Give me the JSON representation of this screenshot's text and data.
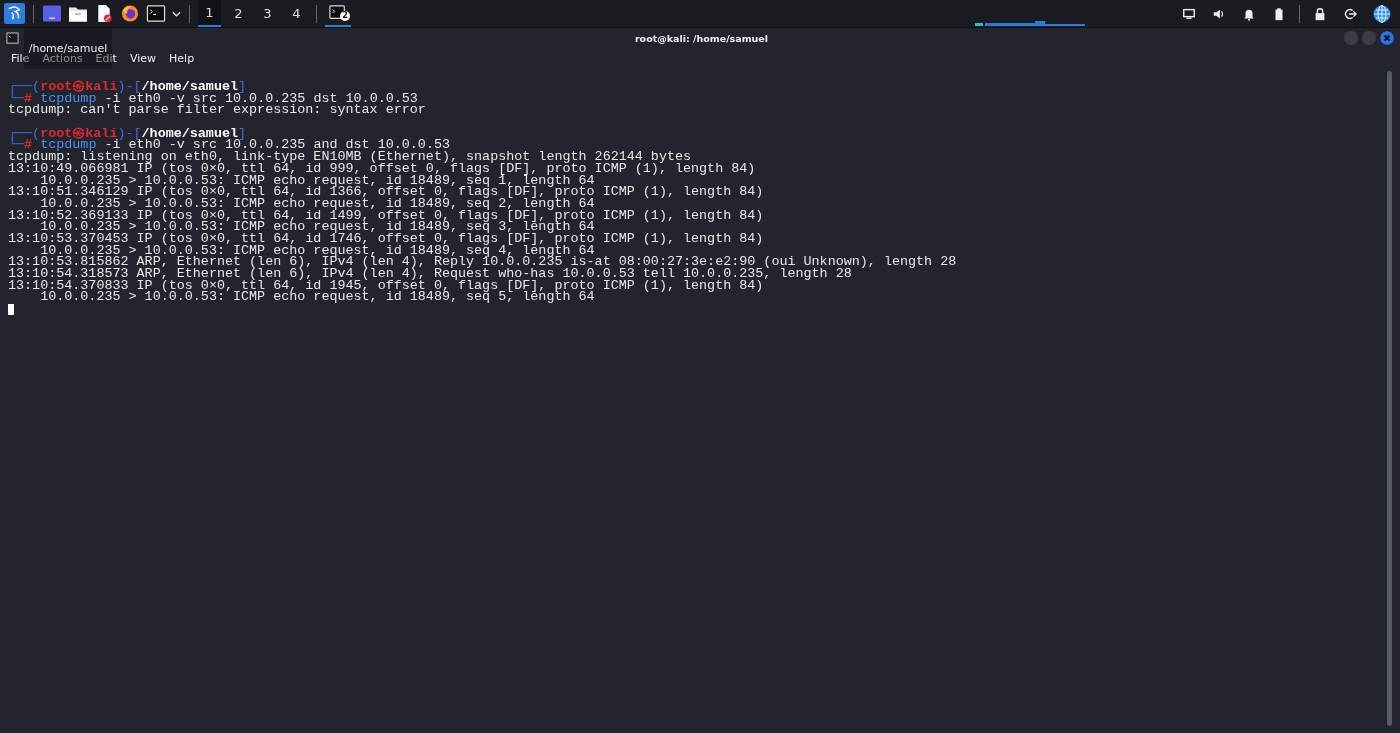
{
  "taskbar": {
    "workspaces": [
      {
        "label": "1",
        "selected": true
      },
      {
        "label": "2",
        "selected": false
      },
      {
        "label": "3",
        "selected": false
      },
      {
        "label": "4",
        "selected": false
      }
    ],
    "task_badge": "2"
  },
  "window": {
    "title": "root@kali: /home/samuel"
  },
  "menu": [
    {
      "label": "File"
    },
    {
      "label": "Actions"
    },
    {
      "label": "Edit"
    },
    {
      "label": "View"
    },
    {
      "label": "Help"
    }
  ],
  "tooltip": "/home/samuel",
  "terminal": {
    "lines": [
      {
        "kind": "prompt_head",
        "open": "┌──(",
        "user": "root",
        "at": "㉿",
        "host": "kali",
        "mid": ")-[",
        "path": "/home/samuel",
        "close": "]"
      },
      {
        "kind": "prompt_cmd",
        "frame": "└─",
        "symbol": "#",
        "program": "tcpdump",
        "args": " -i eth0 -v src 10.0.0.235 dst 10.0.0.53"
      },
      {
        "kind": "output",
        "text": "tcpdump: can't parse filter expression: syntax error"
      },
      {
        "kind": "blank"
      },
      {
        "kind": "prompt_head",
        "open": "┌──(",
        "user": "root",
        "at": "㉿",
        "host": "kali",
        "mid": ")-[",
        "path": "/home/samuel",
        "close": "]"
      },
      {
        "kind": "prompt_cmd",
        "frame": "└─",
        "symbol": "#",
        "program": "tcpdump",
        "args": " -i eth0 -v src 10.0.0.235 and dst 10.0.0.53"
      },
      {
        "kind": "output",
        "text": "tcpdump: listening on eth0, link-type EN10MB (Ethernet), snapshot length 262144 bytes"
      },
      {
        "kind": "output",
        "text": "13:10:49.066981 IP (tos 0×0, ttl 64, id 999, offset 0, flags [DF], proto ICMP (1), length 84)"
      },
      {
        "kind": "output",
        "text": "    10.0.0.235 > 10.0.0.53: ICMP echo request, id 18489, seq 1, length 64"
      },
      {
        "kind": "output",
        "text": "13:10:51.346129 IP (tos 0×0, ttl 64, id 1366, offset 0, flags [DF], proto ICMP (1), length 84)"
      },
      {
        "kind": "output",
        "text": "    10.0.0.235 > 10.0.0.53: ICMP echo request, id 18489, seq 2, length 64"
      },
      {
        "kind": "output",
        "text": "13:10:52.369133 IP (tos 0×0, ttl 64, id 1499, offset 0, flags [DF], proto ICMP (1), length 84)"
      },
      {
        "kind": "output",
        "text": "    10.0.0.235 > 10.0.0.53: ICMP echo request, id 18489, seq 3, length 64"
      },
      {
        "kind": "output",
        "text": "13:10:53.370453 IP (tos 0×0, ttl 64, id 1746, offset 0, flags [DF], proto ICMP (1), length 84)"
      },
      {
        "kind": "output",
        "text": "    10.0.0.235 > 10.0.0.53: ICMP echo request, id 18489, seq 4, length 64"
      },
      {
        "kind": "output",
        "text": "13:10:53.815862 ARP, Ethernet (len 6), IPv4 (len 4), Reply 10.0.0.235 is-at 08:00:27:3e:e2:90 (oui Unknown), length 28"
      },
      {
        "kind": "output",
        "text": "13:10:54.318573 ARP, Ethernet (len 6), IPv4 (len 4), Request who-has 10.0.0.53 tell 10.0.0.235, length 28"
      },
      {
        "kind": "output",
        "text": "13:10:54.370833 IP (tos 0×0, ttl 64, id 1945, offset 0, flags [DF], proto ICMP (1), length 84)"
      },
      {
        "kind": "output",
        "text": "    10.0.0.235 > 10.0.0.53: ICMP echo request, id 18489, seq 5, length 64"
      },
      {
        "kind": "cursor"
      }
    ]
  }
}
